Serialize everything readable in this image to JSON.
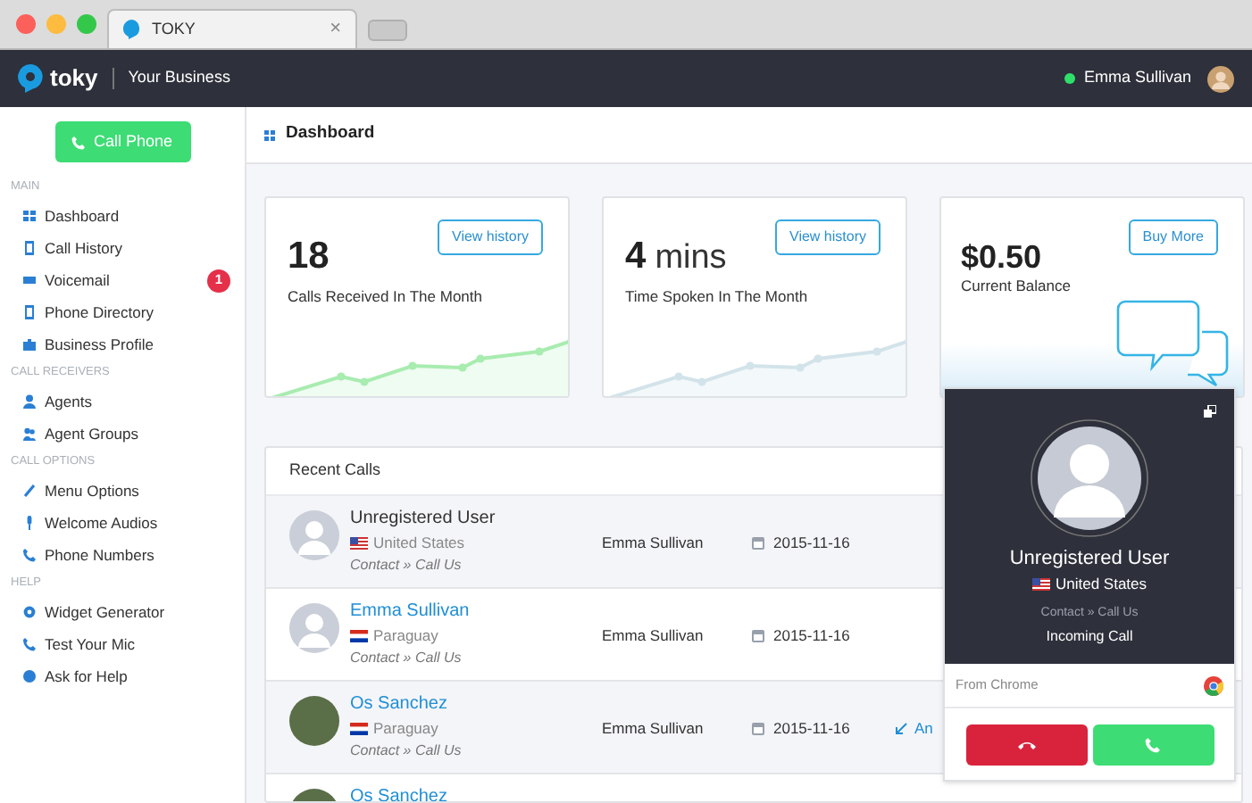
{
  "browser": {
    "tab_title": "TOKY",
    "tab_close": "×"
  },
  "header": {
    "brand": "toky",
    "business": "Your Business",
    "user": {
      "name": "Emma Sullivan",
      "online": true
    }
  },
  "sidebar": {
    "call_button": "Call Phone",
    "sections": [
      {
        "heading": "MAIN",
        "items": [
          {
            "label": "Dashboard"
          },
          {
            "label": "Call History"
          },
          {
            "label": "Voicemail",
            "badge": "1"
          },
          {
            "label": "Phone Directory"
          },
          {
            "label": "Business Profile"
          }
        ]
      },
      {
        "heading": "CALL RECEIVERS",
        "items": [
          {
            "label": "Agents"
          },
          {
            "label": "Agent Groups"
          }
        ]
      },
      {
        "heading": "CALL OPTIONS",
        "items": [
          {
            "label": "Menu Options"
          },
          {
            "label": "Welcome Audios"
          },
          {
            "label": "Phone Numbers"
          }
        ]
      },
      {
        "heading": "HELP",
        "items": [
          {
            "label": "Widget Generator"
          },
          {
            "label": "Test Your Mic"
          },
          {
            "label": "Ask for Help"
          }
        ]
      }
    ]
  },
  "page_title": "Dashboard",
  "cards": [
    {
      "kind": "sparkline",
      "highlighted": true,
      "value": "18",
      "label": "Calls Received In The Month",
      "button": "View history"
    },
    {
      "kind": "sparkline",
      "highlighted": false,
      "value": "4",
      "unit": "mins",
      "label": "Time Spoken In The Month",
      "button": "View history"
    },
    {
      "kind": "balance",
      "value": "$0.50",
      "label": "Current Balance",
      "button": "Buy More"
    }
  ],
  "recent_calls": {
    "title": "Recent Calls",
    "rows": [
      {
        "caller": "Unregistered User",
        "linked": false,
        "avatar": {
          "kind": "silhouette"
        },
        "flag": {
          "kind": "us"
        },
        "country": "United States",
        "source": "Contact » Call Us",
        "agent": "Emma Sullivan",
        "date": "2015-11-16"
      },
      {
        "caller": "Emma Sullivan",
        "linked": true,
        "avatar": {
          "kind": "silhouette"
        },
        "flag": {
          "kind": "py"
        },
        "country": "Paraguay",
        "source": "Contact » Call Us",
        "agent": "Emma Sullivan",
        "date": "2015-11-16"
      },
      {
        "caller": "Os Sanchez",
        "linked": true,
        "avatar": {
          "kind": "photo"
        },
        "flag": {
          "kind": "py"
        },
        "country": "Paraguay",
        "source": "Contact » Call Us",
        "agent": "Emma Sullivan",
        "date": "2015-11-16",
        "action": "An"
      },
      {
        "caller": "Os Sanchez",
        "linked": true,
        "avatar": {
          "kind": "photo"
        }
      }
    ]
  },
  "call_popup": {
    "caller": "Unregistered User",
    "flag": {
      "kind": "us"
    },
    "country": "United States",
    "source": "Contact » Call Us",
    "status": "Incoming Call",
    "from": "From Chrome"
  }
}
